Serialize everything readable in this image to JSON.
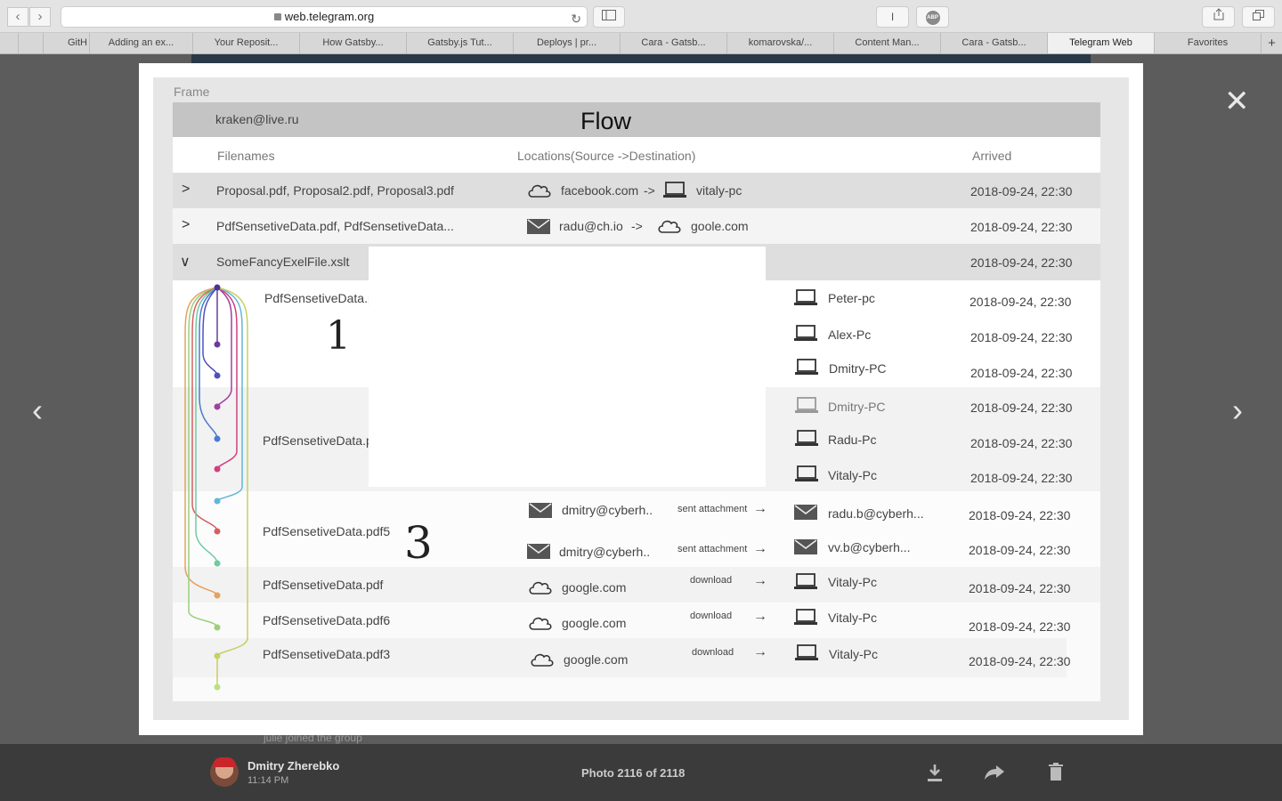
{
  "browser": {
    "url": "web.telegram.org",
    "tabs": [
      "GitH",
      "Adding an ex...",
      "Your Reposit...",
      "How Gatsby...",
      "Gatsby.js Tut...",
      "Deploys | pr...",
      "Cara - Gatsb...",
      "komarovska/...",
      "Content Man...",
      "Cara - Gatsb...",
      "Telegram Web",
      "Favorites"
    ],
    "active_tab": "Telegram Web",
    "reader_label": "I",
    "abp_label": "ABP"
  },
  "photo": {
    "frame_label": "Frame",
    "email": "kraken@live.ru",
    "title": "Flow",
    "columns": {
      "filenames": "Filenames",
      "locations": "Locations(Source ->Destination)",
      "arrived": "Arrived"
    },
    "rows": {
      "r1": {
        "name": "Proposal.pdf, Proposal2.pdf, Proposal3.pdf",
        "src": "facebook.com",
        "sep": "->",
        "dst": "vitaly-pc",
        "date": "2018-09-24, 22:30"
      },
      "r2": {
        "name": "PdfSensetiveData.pdf, PdfSensetiveData...",
        "src": "radu@ch.io",
        "sep": "->",
        "dst": "goole.com",
        "date": "2018-09-24, 22:30"
      },
      "r3": {
        "name": "SomeFancyExelFile.xslt",
        "date": "2018-09-24, 22:30"
      },
      "g1": {
        "name": "PdfSensetiveData.p",
        "dests": [
          "Peter-pc",
          "Alex-Pc",
          "Dmitry-PC"
        ],
        "dates": [
          "2018-09-24, 22:30",
          "2018-09-24, 22:30",
          "2018-09-24, 22:30"
        ]
      },
      "g2": {
        "name": "PdfSensetiveData.p",
        "dests": [
          "Dmitry-PC",
          "Radu-Pc",
          "Vitaly-Pc"
        ],
        "dates": [
          "2018-09-24, 22:30",
          "2018-09-24, 22:30",
          "2018-09-24, 22:30"
        ]
      },
      "g3": {
        "name": "PdfSensetiveData.pdf5",
        "sub": [
          {
            "src": "dmitry@cyberh..",
            "action": "sent attachment",
            "dst": "radu.b@cyberh...",
            "date": "2018-09-24, 22:30"
          },
          {
            "src": "dmitry@cyberh..",
            "action": "sent attachment",
            "dst": "vv.b@cyberh...",
            "date": "2018-09-24, 22:30"
          }
        ]
      },
      "r4": {
        "name": "PdfSensetiveData.pdf",
        "src": "google.com",
        "action": "download",
        "dst": "Vitaly-Pc",
        "date": "2018-09-24, 22:30"
      },
      "r5": {
        "name": "PdfSensetiveData.pdf6",
        "src": "google.com",
        "action": "download",
        "dst": "Vitaly-Pc",
        "date": "2018-09-24, 22:30"
      },
      "r6": {
        "name": "PdfSensetiveData.pdf3",
        "src": "google.com",
        "action": "download",
        "dst": "Vitaly-Pc",
        "date": "2018-09-24, 22:30"
      }
    },
    "annotations": {
      "one": "1",
      "three": "3"
    }
  },
  "viewer": {
    "author": "Dmitry Zherebko",
    "time": "11:14 PM",
    "counter": "Photo 2116 of 2118",
    "behind_text": "julie joined the group"
  }
}
